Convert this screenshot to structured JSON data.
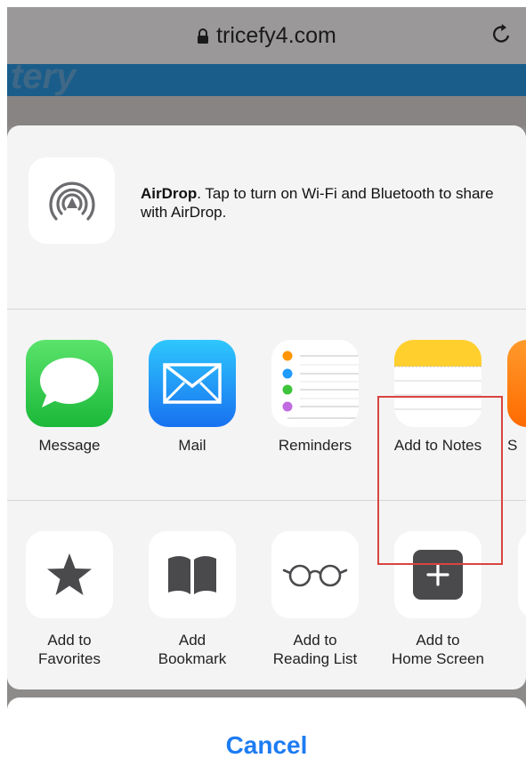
{
  "browser": {
    "domain": "tricefy4.com",
    "lock_icon": "lock-icon",
    "reload_icon": "reload-icon"
  },
  "background_site": {
    "partial_logo": "tery"
  },
  "airdrop": {
    "title": "AirDrop",
    "message": ". Tap to turn on Wi-Fi and Bluetooth to share with AirDrop.",
    "icon": "airdrop-icon"
  },
  "apps": [
    {
      "label": "Message",
      "icon": "message-icon"
    },
    {
      "label": "Mail",
      "icon": "mail-icon"
    },
    {
      "label": "Reminders",
      "icon": "reminders-icon"
    },
    {
      "label": "Add to Notes",
      "icon": "notes-icon"
    },
    {
      "label": "S",
      "icon": "partial-app-icon"
    }
  ],
  "actions": [
    {
      "line1": "Add to",
      "line2": "Favorites",
      "icon": "star-icon"
    },
    {
      "line1": "Add",
      "line2": "Bookmark",
      "icon": "book-icon"
    },
    {
      "line1": "Add to",
      "line2": "Reading List",
      "icon": "glasses-icon"
    },
    {
      "line1": "Add to",
      "line2": "Home Screen",
      "icon": "plus-square-icon"
    }
  ],
  "highlight_color": "#d9443f",
  "cancel": {
    "label": "Cancel",
    "color": "#1e7cf2"
  }
}
